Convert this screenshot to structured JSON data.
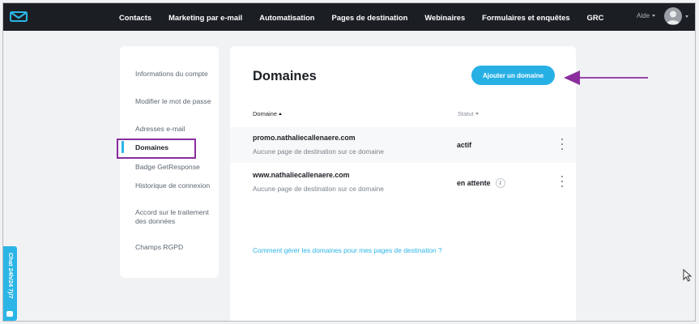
{
  "nav": {
    "items": [
      "Contacts",
      "Marketing par e-mail",
      "Automatisation",
      "Pages de destination",
      "Webinaires",
      "Formulaires et enquêtes",
      "GRC"
    ],
    "help_label": "Aide"
  },
  "sidebar": {
    "items": [
      {
        "label": "Informations du compte"
      },
      {
        "label": "Modifier le mot de passe"
      },
      {
        "label": "Adresses e-mail"
      },
      {
        "label": "Domaines"
      },
      {
        "label": "Badge GetResponse"
      },
      {
        "label": "Historique de connexion"
      },
      {
        "label": "Accord sur le traitement des données"
      },
      {
        "label": "Champs RGPD"
      }
    ],
    "active": "Domaines"
  },
  "main": {
    "title": "Domaines",
    "add_button_label": "Ajouter un domaine",
    "columns": {
      "domain": "Domaine",
      "status": "Statut"
    },
    "rows": [
      {
        "domain": "promo.nathaliecallenaere.com",
        "subtitle": "Aucune page de destination sur ce domaine",
        "status": "actif"
      },
      {
        "domain": "www.nathaliecallenaere.com",
        "subtitle": "Aucune page de destination sur ce domaine",
        "status": "en attente",
        "info": "i"
      }
    ],
    "help_link": "Comment gérer les domaines pour mes pages de destination ?"
  },
  "chat": {
    "label": "Chat 24h/24 7j/7"
  },
  "colors": {
    "accent": "#27b0e4",
    "annotation": "#8a2e9d",
    "topbar": "#1b1f24"
  },
  "icons": [
    "envelope-logo-icon",
    "avatar-icon",
    "info-icon",
    "kebab-menu-icon",
    "chat-icon",
    "arrow-annotation-icon",
    "mouse-cursor-icon"
  ]
}
